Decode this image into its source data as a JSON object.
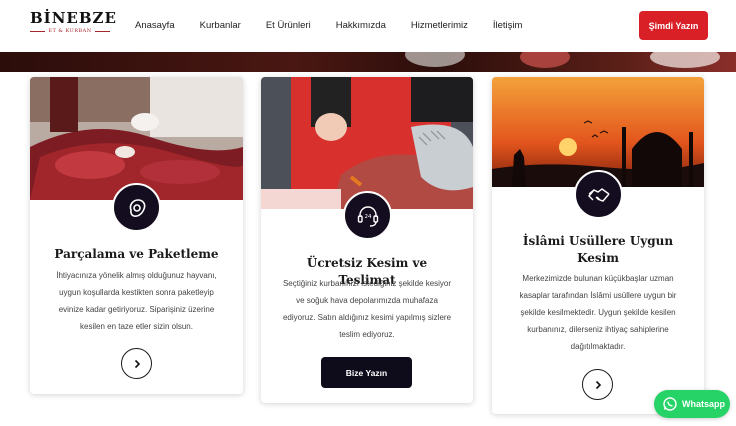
{
  "brand": {
    "name": "BİNEBZE",
    "tagline": "ET & KURBAN"
  },
  "nav": {
    "items": [
      "Anasayfa",
      "Kurbanlar",
      "Et Ürünleri",
      "Hakkımızda",
      "Hizmetlerimiz",
      "İletişim"
    ],
    "cta_label": "Şimdi Yazın"
  },
  "cards": [
    {
      "title": "Parçalama ve Paketleme",
      "description": "İhtiyacınıza yönelik almış olduğunuz hayvanı, uygun koşullarda kestikten sonra paketleyip evinize kadar getiriyoruz. Siparişiniz üzerine kesilen en taze etler sizin olsun.",
      "icon": "meat-icon"
    },
    {
      "title": "Ücretsiz Kesim ve Teslimat",
      "description": "Seçtiğiniz kurbanınızı istediğiniz şekilde kesiyor ve soğuk hava depolarımızda muhafaza ediyoruz. Satın aldığınız kesimi yapılmış sizlere teslim ediyoruz.",
      "icon": "support-headset-icon",
      "button_label": "Bize Yazın"
    },
    {
      "title": "İslâmi Usüllere Uygun Kesim",
      "description": "Merkezimizde bulunan küçükbaşlar uzman kasaplar tarafından İslâmi usüllere uygun bir şekilde kesilmektedir. Uygun şekilde kesilen kurbanınız, dilerseniz ihtiyaç sahiplerine dağıtılmaktadır.",
      "icon": "handshake-icon"
    }
  ],
  "whatsapp": {
    "label": "Whatsapp"
  },
  "colors": {
    "accent": "#d92027",
    "dark": "#140d1f",
    "whatsapp": "#25d366"
  }
}
